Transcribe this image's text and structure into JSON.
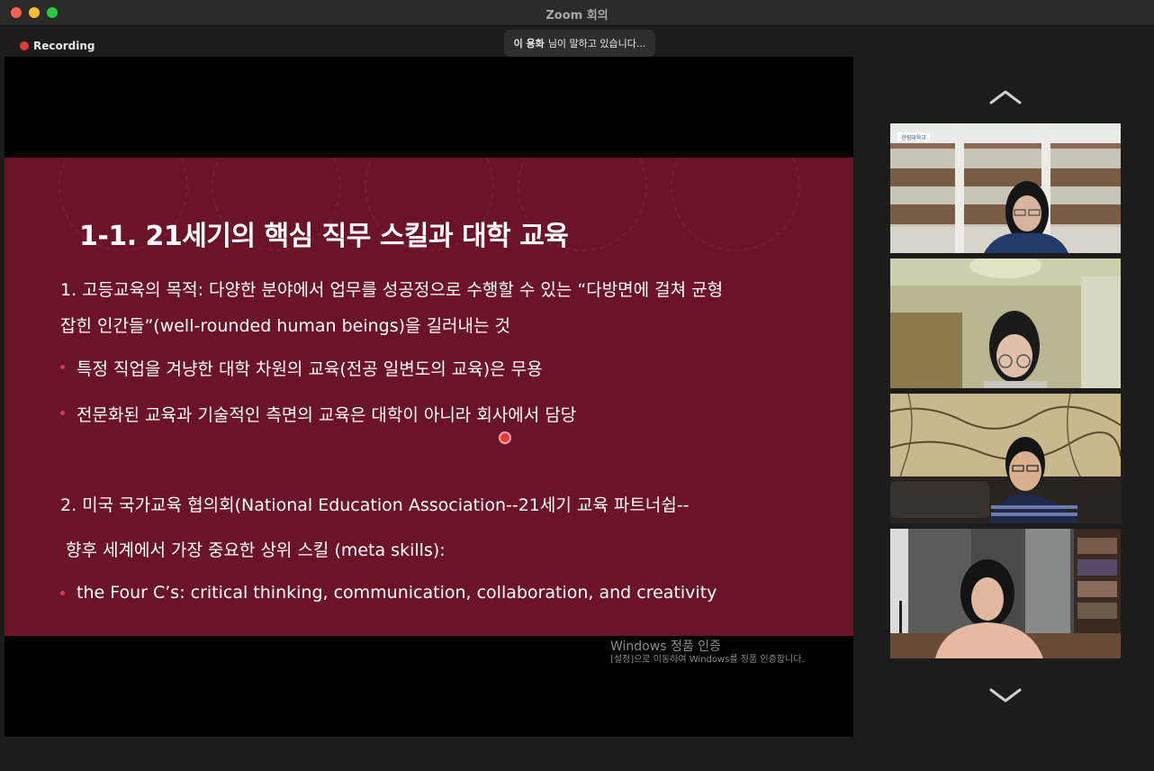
{
  "window": {
    "title": "Zoom 회의"
  },
  "recording": {
    "label": "Recording"
  },
  "speaker_notice": {
    "name": "이 용화",
    "text": "님이 말하고 있습니다..."
  },
  "slide": {
    "title": "1-1. 21세기의 핵심 직무 스킬과 대학 교육",
    "lines": [
      "1. 고등교육의 목적: 다양한 분야에서 업무를 성공정으로 수행할 수 있는 “다방면에 걸쳐 균형",
      "잡힌 인간들”(well-rounded human beings)을 길러내는 것",
      "특정 직업을 겨냥한 대학 차원의 교육(전공 일변도의 교육)은 무용",
      "전문화된 교육과 기술적인 측면의 교육은 대학이 아니라 회사에서 담당",
      "2. 미국 국가교육 협의회(National Education Association--21세기 교육 파트너쉽--",
      "향후 세계에서 가장 중요한 상위 스킬 (meta skills):",
      "the Four C’s: critical thinking, communication, collaboration, and creativity"
    ]
  },
  "watermark": {
    "title": "Windows 정품 인증",
    "subtitle": "[설정]으로 이동하여 Windows를 정품 인증합니다."
  },
  "gallery": {
    "participant1_logo": "한림대학교"
  }
}
